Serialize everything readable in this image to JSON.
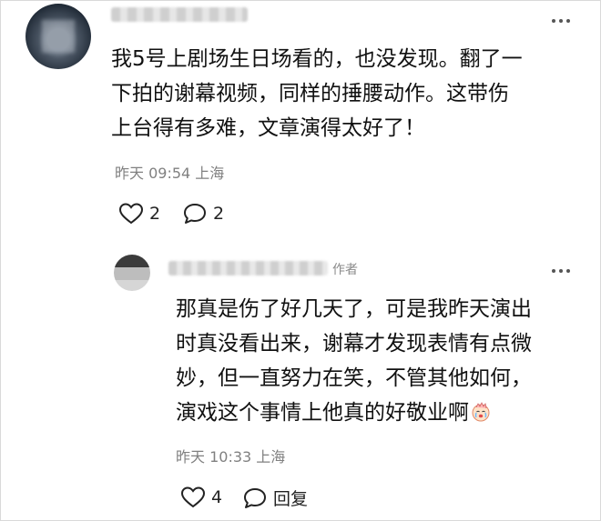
{
  "comment": {
    "text_lines": [
      "我5号上剧场生日场看的，也没发现。翻了一",
      "下拍的谢幕视频，同样的捶腰动作。这带伤",
      "上台得有多难，文章演得太好了！"
    ],
    "timestamp": "昨天 09:54 上海",
    "likes": "2",
    "replies": "2"
  },
  "reply": {
    "author_tag": "作者",
    "text_lines": [
      "那真是伤了好几天了，可是我昨天演出",
      "时真没看出来，谢幕才发现表情有点微",
      "妙，但一直努力在笑，不管其他如何，",
      "演戏这个事情上他真的好敬业啊"
    ],
    "timestamp": "昨天 10:33 上海",
    "likes": "4",
    "reply_label": "回复"
  },
  "icons": {
    "like": "heart-outline-icon",
    "comment": "speech-bubble-icon",
    "more": "more-dots-icon",
    "emoji": "crying-face-emoji"
  },
  "colors": {
    "text": "#111111",
    "meta": "#808080",
    "icon": "#222222"
  }
}
